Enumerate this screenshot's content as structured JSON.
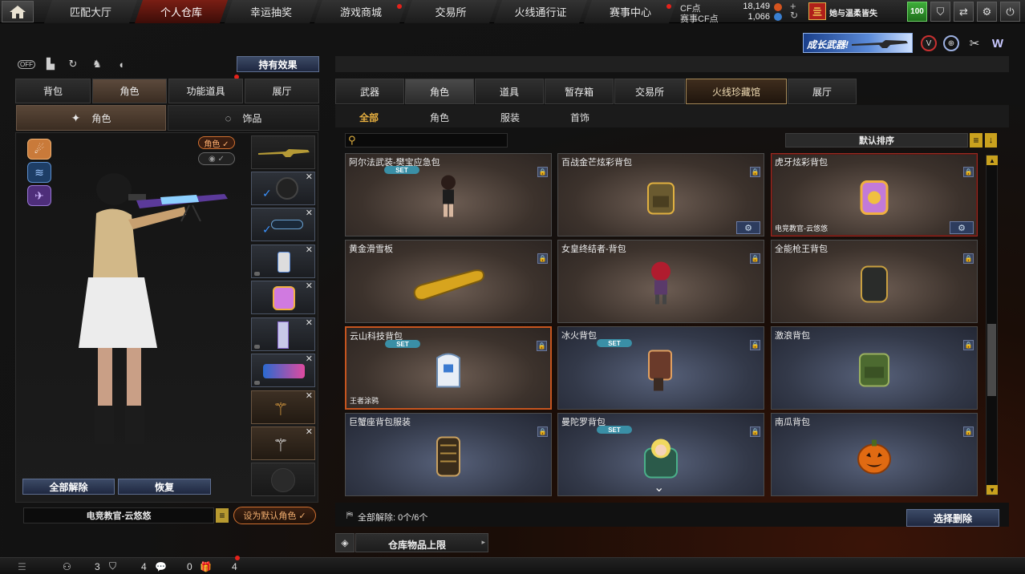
{
  "top_nav": {
    "tabs": [
      {
        "label": "匹配大厅",
        "active": false,
        "dot": false
      },
      {
        "label": "个人仓库",
        "active": true,
        "dot": false
      },
      {
        "label": "幸运抽奖",
        "active": false,
        "dot": false
      },
      {
        "label": "游戏商城",
        "active": false,
        "dot": true
      },
      {
        "label": "交易所",
        "active": false,
        "dot": false
      },
      {
        "label": "火线通行证",
        "active": false,
        "dot": false
      },
      {
        "label": "赛事中心",
        "active": false,
        "dot": true
      }
    ],
    "cf_label": "CF点",
    "cf_value": "18,149",
    "match_cf_label": "赛事CF点",
    "match_cf_value": "1,066",
    "player_name": "她与温柔皆失",
    "level_badge": "100"
  },
  "banner": {
    "text": "成长武器!"
  },
  "left_panel": {
    "off_label": "OFF",
    "effects_button": "持有效果",
    "tabs": [
      {
        "label": "背包",
        "active": false
      },
      {
        "label": "角色",
        "active": true
      },
      {
        "label": "功能道具",
        "active": false
      },
      {
        "label": "展厅",
        "active": false
      }
    ],
    "subtabs": [
      {
        "label": "角色",
        "active": true
      },
      {
        "label": "饰品",
        "active": false
      }
    ],
    "role_toggle": "角色 ✓",
    "unequip_all": "全部解除",
    "restore": "恢复",
    "character_name": "电竞教官-云悠悠",
    "set_default": "设为默认角色 ✓"
  },
  "right_panel": {
    "tabs": [
      {
        "label": "武器",
        "active": false
      },
      {
        "label": "角色",
        "active": true
      },
      {
        "label": "道具",
        "active": false
      },
      {
        "label": "暂存箱",
        "active": false
      },
      {
        "label": "交易所",
        "active": false
      },
      {
        "label": "火线珍藏馆",
        "active": false,
        "special": true
      },
      {
        "label": "展厅",
        "active": false
      }
    ],
    "filters": [
      {
        "label": "全部",
        "active": true
      },
      {
        "label": "角色",
        "active": false
      },
      {
        "label": "服装",
        "active": false
      },
      {
        "label": "首饰",
        "active": false
      }
    ],
    "search_placeholder": "",
    "sort_label": "默认排序",
    "items": [
      {
        "title": "阿尔法武装-樊宝应急包",
        "set": true,
        "footer": "",
        "theme": "warm",
        "gear": false,
        "art": "girl-icon"
      },
      {
        "title": "百战金芒炫彩背包",
        "set": false,
        "footer": "",
        "theme": "warm",
        "gear": true,
        "art": "backpack-icon"
      },
      {
        "title": "虎牙炫彩背包",
        "set": false,
        "footer": "电竞教官-云悠悠",
        "theme": "warm",
        "gear": true,
        "art": "purple-backpack-icon"
      },
      {
        "title": "黄金滑雪板",
        "set": false,
        "footer": "",
        "theme": "warm",
        "gear": false,
        "art": "snowboard-icon"
      },
      {
        "title": "女皇终结者-背包",
        "set": false,
        "footer": "",
        "theme": "warm",
        "gear": false,
        "art": "doll-icon"
      },
      {
        "title": "全能枪王背包",
        "set": false,
        "footer": "",
        "theme": "warm",
        "gear": false,
        "art": "dark-backpack-icon"
      },
      {
        "title": "云山科技背包",
        "set": true,
        "footer": "王者涂鸦",
        "theme": "warm",
        "gear": false,
        "art": "white-backpack-icon"
      },
      {
        "title": "冰火背包",
        "set": true,
        "footer": "",
        "theme": "cool",
        "gear": false,
        "art": "canister-icon"
      },
      {
        "title": "激浪背包",
        "set": false,
        "footer": "",
        "theme": "cool",
        "gear": false,
        "art": "camo-backpack-icon"
      },
      {
        "title": "巨蟹座背包服装",
        "set": false,
        "footer": "",
        "theme": "cool",
        "gear": false,
        "art": "gold-pack-icon"
      },
      {
        "title": "曼陀罗背包",
        "set": true,
        "footer": "",
        "theme": "cool",
        "gear": false,
        "art": "blonde-girl-icon"
      },
      {
        "title": "南瓜背包",
        "set": false,
        "footer": "",
        "theme": "cool",
        "gear": false,
        "art": "pumpkin-icon"
      }
    ],
    "unequip_status": "全部解除: 0个/6个",
    "select_delete": "选择删除",
    "storage_limit": "仓库物品上限"
  },
  "bottom_bar": {
    "counts": [
      "3",
      "4",
      "0",
      "4"
    ]
  },
  "colors": {
    "accent_red": "#7a1e14",
    "set_badge": "#3a8fa6",
    "button_blue": "#2d3c5e",
    "scroll_gold": "#c9a11e"
  }
}
